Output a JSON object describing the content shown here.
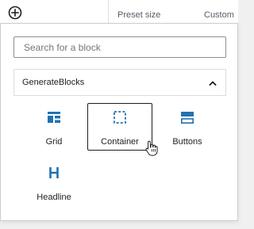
{
  "topbar": {
    "preset_label": "Preset size",
    "custom_label": "Custom",
    "add_icon": "plus-circle-icon"
  },
  "inserter": {
    "search": {
      "placeholder": "Search for a block",
      "value": ""
    },
    "category": {
      "title": "GenerateBlocks",
      "expanded": true,
      "toggle_icon": "chevron-up-icon"
    },
    "blocks": [
      {
        "label": "Grid",
        "icon": "grid-icon"
      },
      {
        "label": "Container",
        "icon": "container-icon",
        "hovered": true
      },
      {
        "label": "Buttons",
        "icon": "buttons-icon"
      },
      {
        "label": "Headline",
        "icon": "headline-icon"
      }
    ]
  },
  "colors": {
    "accent": "#2271b1",
    "text": "#1e1e1e",
    "border": "#8c8f94",
    "panel_bg": "#ffffff",
    "canvas_bg": "#f0f0f1"
  }
}
